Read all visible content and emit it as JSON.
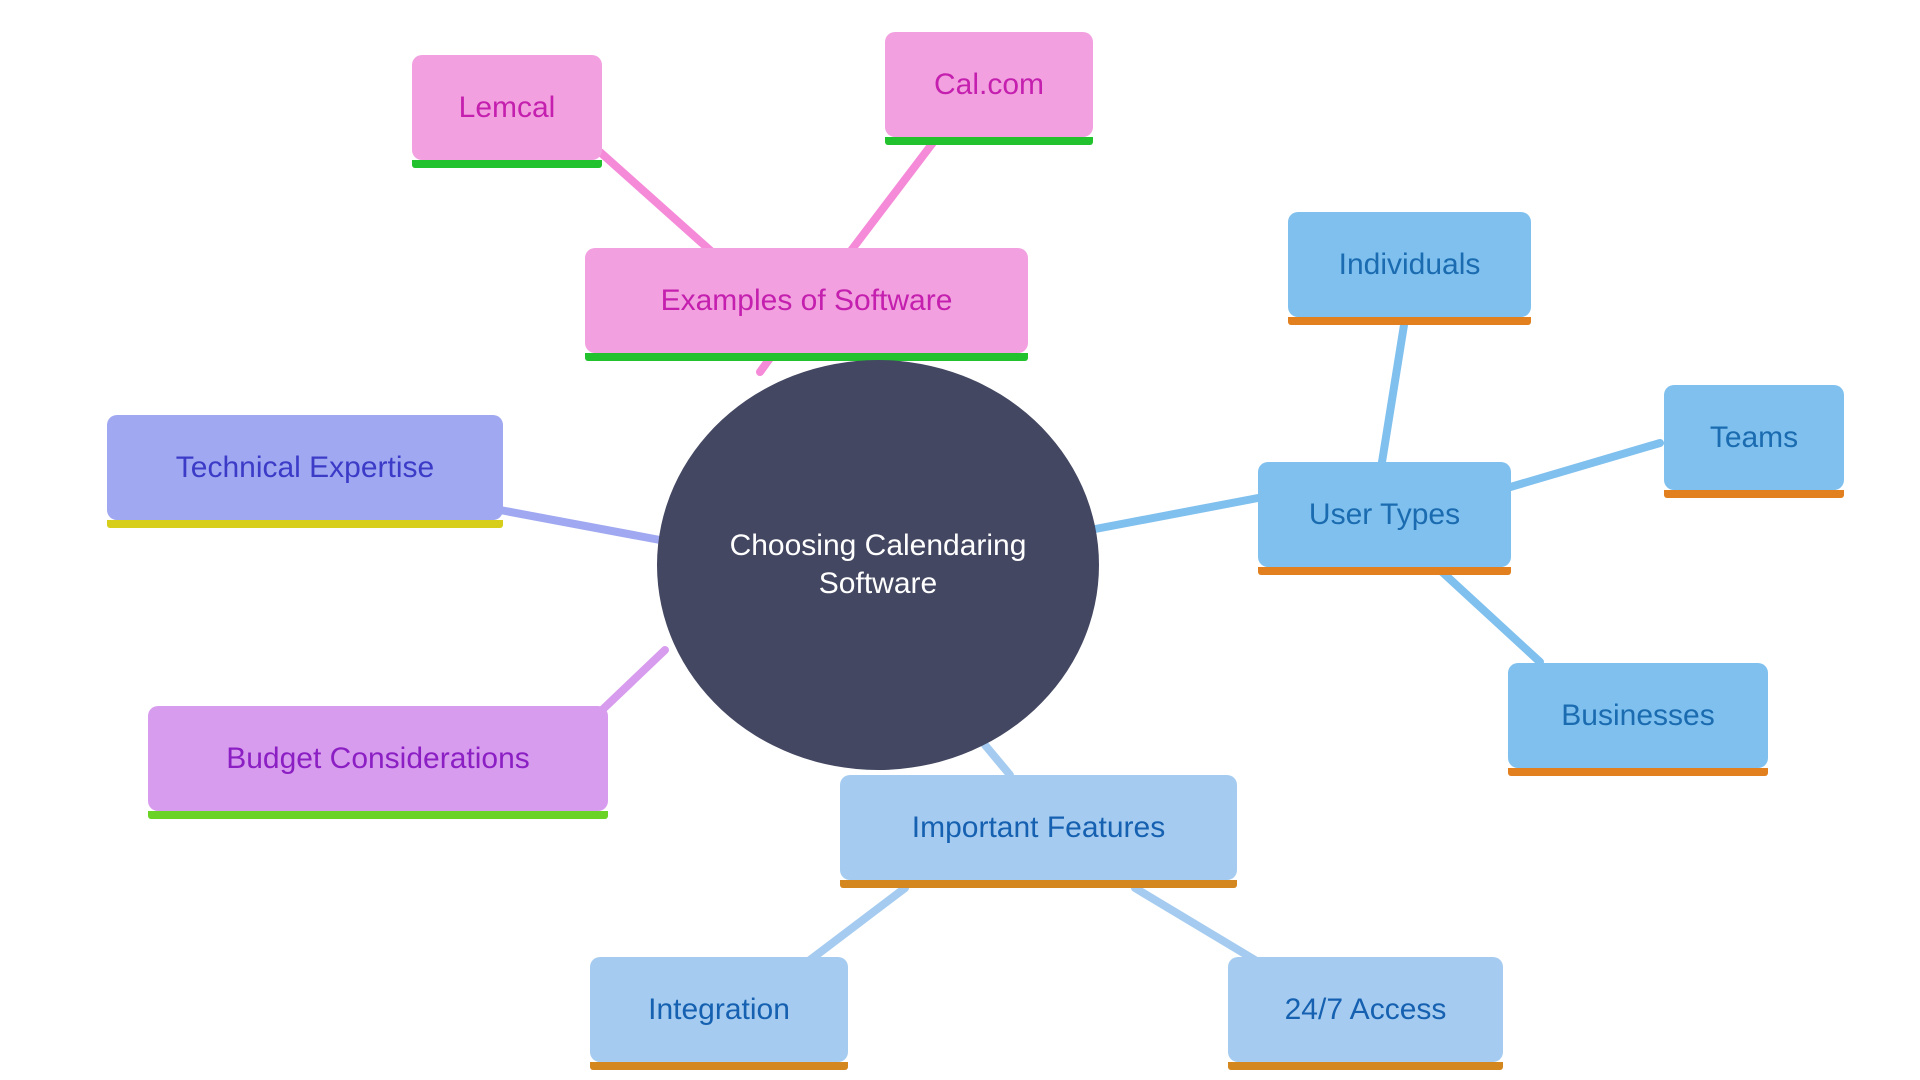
{
  "diagram": {
    "type": "mind-map",
    "title": "Choosing Calendaring Software",
    "background": "#ffffff",
    "root": {
      "id": "root",
      "label": "Choosing Calendaring Software",
      "fill": "#434761",
      "text_color": "#ffffff",
      "shape": "ellipse",
      "font_size": 30
    },
    "branches": [
      {
        "id": "examples-of-software",
        "label": "Examples of Software",
        "fill": "#F2A0E0",
        "accent": "#22C22E",
        "text_color": "#C41FAE",
        "edge_color": "#F58AD8",
        "font_size": 30,
        "children": [
          {
            "id": "lemcal",
            "label": "Lemcal",
            "fill": "#F2A0E0",
            "accent": "#22C22E",
            "text_color": "#C41FAE",
            "edge_color": "#F58AD8",
            "font_size": 30
          },
          {
            "id": "cal-com",
            "label": "Cal.com",
            "fill": "#F2A0E0",
            "accent": "#22C22E",
            "text_color": "#C41FAE",
            "edge_color": "#F58AD8",
            "font_size": 30
          }
        ]
      },
      {
        "id": "user-types",
        "label": "User Types",
        "fill": "#7FC0EE",
        "accent": "#E2801F",
        "text_color": "#1A6BB0",
        "edge_color": "#7FC0EE",
        "font_size": 30,
        "children": [
          {
            "id": "individuals",
            "label": "Individuals",
            "fill": "#7FC0EE",
            "accent": "#E2801F",
            "text_color": "#1A6BB0",
            "edge_color": "#7FC0EE",
            "font_size": 30
          },
          {
            "id": "teams",
            "label": "Teams",
            "fill": "#7FC0EE",
            "accent": "#E2801F",
            "text_color": "#1A6BB0",
            "edge_color": "#7FC0EE",
            "font_size": 30
          },
          {
            "id": "businesses",
            "label": "Businesses",
            "fill": "#7FC0EE",
            "accent": "#E2801F",
            "text_color": "#1A6BB0",
            "edge_color": "#7FC0EE",
            "font_size": 30
          }
        ]
      },
      {
        "id": "important-features",
        "label": "Important Features",
        "fill": "#A5CCF0",
        "accent": "#D4861F",
        "text_color": "#1560B0",
        "edge_color": "#A5CCF0",
        "font_size": 30,
        "children": [
          {
            "id": "integration",
            "label": "Integration",
            "fill": "#A5CCF0",
            "accent": "#D4861F",
            "text_color": "#1560B0",
            "edge_color": "#A5CCF0",
            "font_size": 30
          },
          {
            "id": "24-7-access",
            "label": "24/7 Access",
            "fill": "#A5CCF0",
            "accent": "#D4861F",
            "text_color": "#1560B0",
            "edge_color": "#A5CCF0",
            "font_size": 30
          }
        ]
      },
      {
        "id": "technical-expertise",
        "label": "Technical Expertise",
        "fill": "#9FA8F0",
        "accent": "#D6CE1A",
        "text_color": "#3B3BC8",
        "edge_color": "#9FA8F0",
        "font_size": 30,
        "children": []
      },
      {
        "id": "budget-considerations",
        "label": "Budget Considerations",
        "fill": "#D89CEE",
        "accent": "#6BD326",
        "text_color": "#8B1FC4",
        "edge_color": "#D89CEE",
        "font_size": 30,
        "children": []
      }
    ]
  }
}
